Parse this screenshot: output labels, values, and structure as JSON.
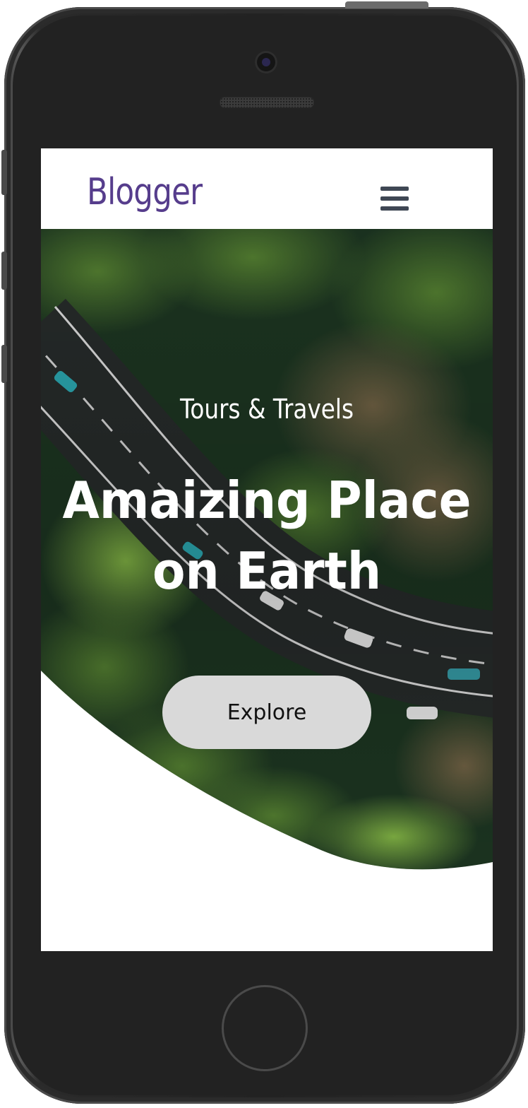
{
  "navbar": {
    "logo_text": "Blogger",
    "menu_icon": "hamburger-menu-icon"
  },
  "hero": {
    "subtitle": "Tours & Travels",
    "title_line1": "Amaizing Place",
    "title_line2": "on Earth",
    "cta_label": "Explore",
    "background_description_icon": "aerial-forest-road-image"
  },
  "colors": {
    "brand": "#563d8c",
    "menu_icon": "#3f4754",
    "hero_text": "#ffffff",
    "cta_background": "#d9d9d9",
    "phone_body": "#222222"
  }
}
